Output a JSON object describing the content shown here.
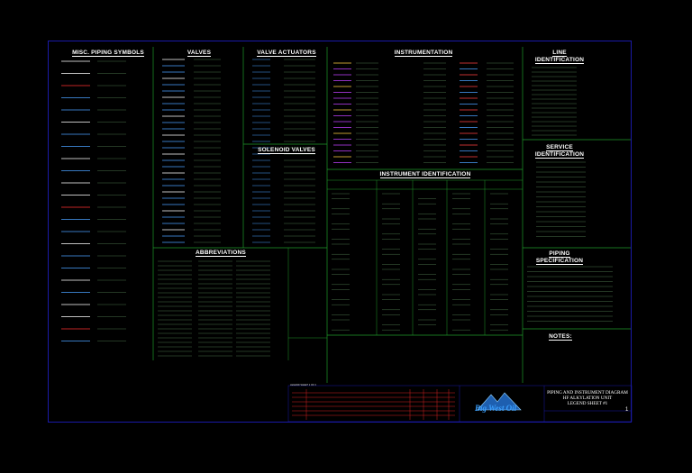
{
  "sections": {
    "misc_piping": "MISC. PIPING SYMBOLS",
    "valves": "VALVES",
    "valve_actuators": "VALVE ACTUATORS",
    "instrumentation": "INSTRUMENTATION",
    "line_identification": "LINE\nIDENTIFICATION",
    "solenoid_valves": "SOLENOID VALVES",
    "instrument_identification": "INSTRUMENT IDENTIFICATION",
    "service_identification": "SERVICE\nIDENTIFICATION",
    "abbreviations": "ABBREVIATIONS",
    "piping_specification": "PIPING\nSPECIFICATION",
    "notes": "NOTES:"
  },
  "title_block": {
    "line1": "PIPING AND INSTRUMENT DIAGRAM",
    "line2": "HF ALKYLATION UNIT",
    "line3": "LEGEND SHEET #1",
    "legend_caption": "LEGEND SHEET 1 OF 3",
    "sheet_number": "1",
    "company": "Big West Oil",
    "colors": {
      "frame": "#1a1aa8",
      "divider": "#1f9a2a",
      "text": "#ffffff",
      "revision": "#d42020",
      "logo": "#3aa0ff"
    }
  }
}
